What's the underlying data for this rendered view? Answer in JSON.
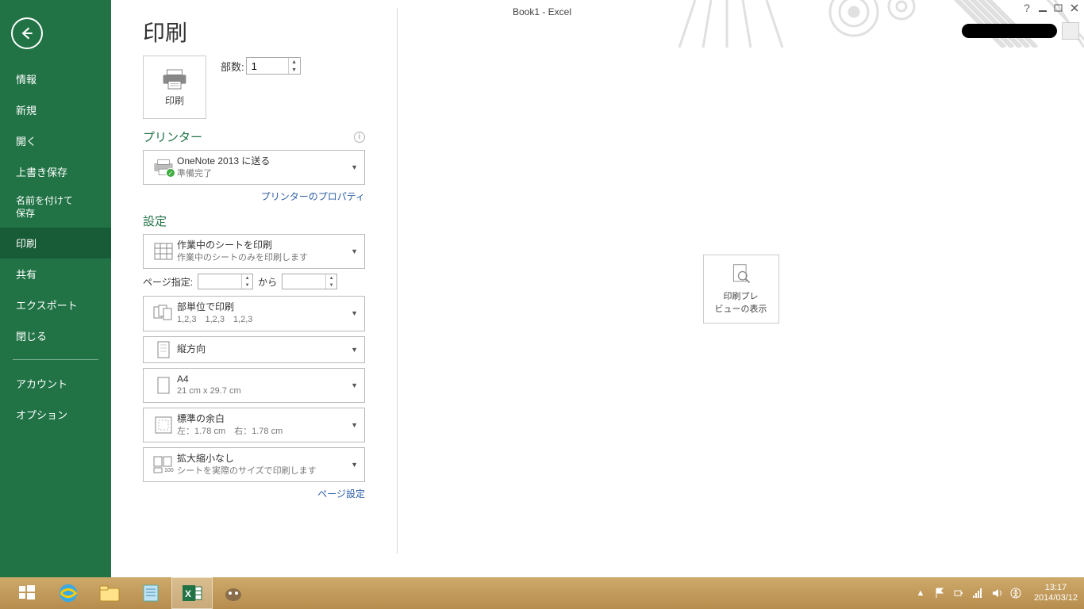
{
  "titlebar": {
    "title": "Book1 - Excel",
    "help": "?"
  },
  "sidebar": {
    "items": [
      "情報",
      "新規",
      "開く",
      "上書き保存",
      "名前を付けて\n保存",
      "印刷",
      "共有",
      "エクスポート",
      "閉じる"
    ],
    "footer": [
      "アカウント",
      "オプション"
    ],
    "active_index": 5
  },
  "page": {
    "title": "印刷"
  },
  "print_button": {
    "label": "印刷"
  },
  "copies": {
    "label": "部数:",
    "value": "1"
  },
  "printer_heading": "プリンター",
  "printer": {
    "name": "OneNote 2013 に送る",
    "status": "準備完了",
    "props_link": "プリンターのプロパティ"
  },
  "settings_heading": "設定",
  "settings": {
    "scope": {
      "title": "作業中のシートを印刷",
      "sub": "作業中のシートのみを印刷します"
    },
    "pages": {
      "label": "ページ指定:",
      "from": "",
      "to_label": "から",
      "to": ""
    },
    "collate": {
      "title": "部単位で印刷",
      "sub": "1,2,3　1,2,3　1,2,3"
    },
    "orient": {
      "title": "縦方向",
      "sub": ""
    },
    "paper": {
      "title": "A4",
      "sub": "21 cm x 29.7 cm"
    },
    "margin": {
      "title": "標準の余白",
      "sub": "左：1.78 cm　右：1.78 cm"
    },
    "scale": {
      "title": "拡大縮小なし",
      "sub": "シートを実際のサイズで印刷します"
    },
    "page_setup_link": "ページ設定"
  },
  "preview": {
    "line1": "印刷プレ",
    "line2": "ビューの表示"
  },
  "taskbar": {
    "time": "13:17",
    "date": "2014/03/12"
  }
}
